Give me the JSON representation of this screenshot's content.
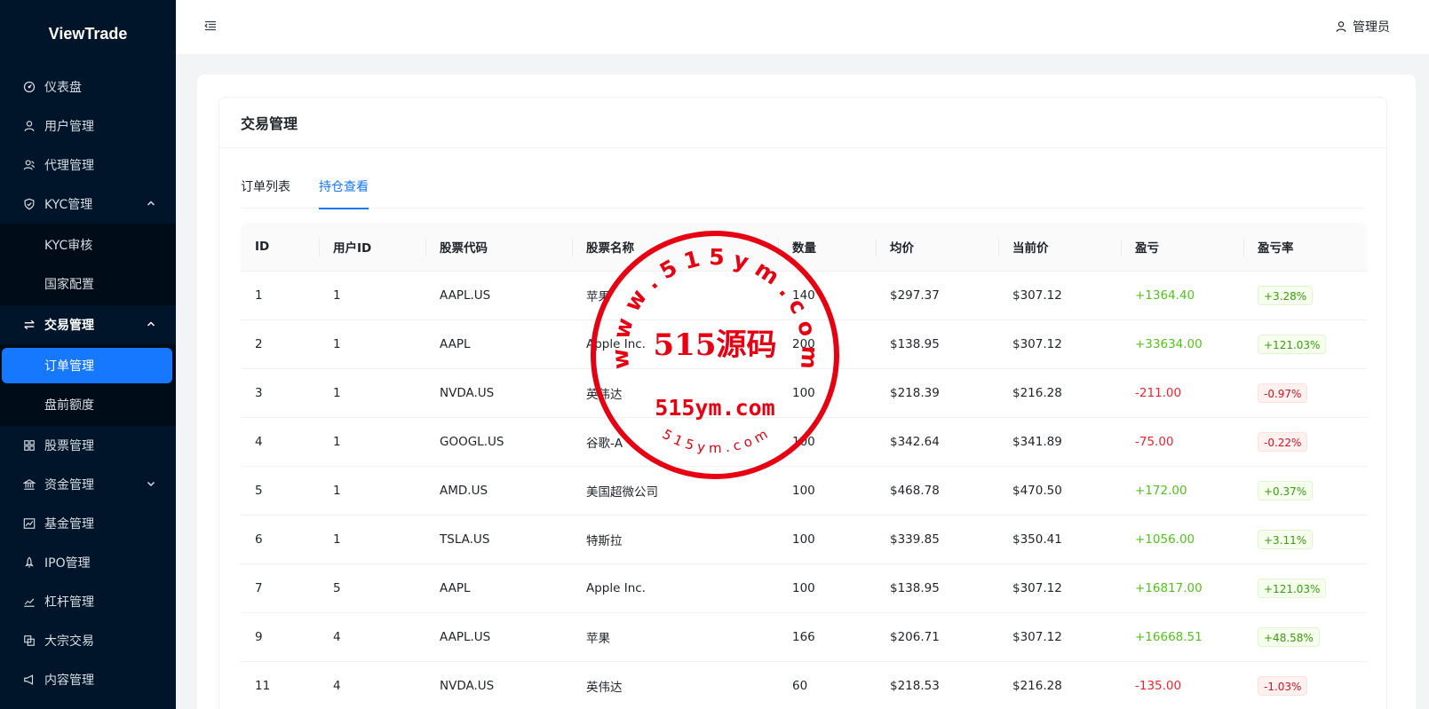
{
  "app": {
    "logo": "ViewTrade"
  },
  "sidebar": {
    "items": [
      {
        "label": "仪表盘",
        "icon": "dashboard-icon"
      },
      {
        "label": "用户管理",
        "icon": "user-icon"
      },
      {
        "label": "代理管理",
        "icon": "agent-icon"
      },
      {
        "label": "KYC管理",
        "icon": "shield-icon",
        "expanded": true,
        "children": [
          {
            "label": "KYC审核"
          },
          {
            "label": "国家配置"
          }
        ]
      },
      {
        "label": "交易管理",
        "icon": "swap-icon",
        "expanded": true,
        "children": [
          {
            "label": "订单管理",
            "selected": true
          },
          {
            "label": "盘前额度"
          }
        ]
      },
      {
        "label": "股票管理",
        "icon": "grid-icon"
      },
      {
        "label": "资金管理",
        "icon": "bank-icon",
        "expanded": false
      },
      {
        "label": "基金管理",
        "icon": "fund-chart-icon"
      },
      {
        "label": "IPO管理",
        "icon": "rocket-icon"
      },
      {
        "label": "杠杆管理",
        "icon": "line-chart-icon"
      },
      {
        "label": "大宗交易",
        "icon": "block-trade-icon"
      },
      {
        "label": "内容管理",
        "icon": "megaphone-icon"
      }
    ]
  },
  "header": {
    "user_label": "管理员"
  },
  "main": {
    "title": "交易管理",
    "tabs": [
      {
        "label": "订单列表",
        "active": false
      },
      {
        "label": "持仓查看",
        "active": true
      }
    ],
    "table": {
      "columns": [
        "ID",
        "用户ID",
        "股票代码",
        "股票名称",
        "数量",
        "均价",
        "当前价",
        "盈亏",
        "盈亏率"
      ],
      "rows": [
        {
          "id": "1",
          "user_id": "1",
          "code": "AAPL.US",
          "name": "苹果",
          "qty": "140",
          "avg": "$297.37",
          "cur": "$307.12",
          "pnl": "+1364.40",
          "rate": "+3.28%",
          "dir": "pos"
        },
        {
          "id": "2",
          "user_id": "1",
          "code": "AAPL",
          "name": "Apple Inc.",
          "qty": "200",
          "avg": "$138.95",
          "cur": "$307.12",
          "pnl": "+33634.00",
          "rate": "+121.03%",
          "dir": "pos"
        },
        {
          "id": "3",
          "user_id": "1",
          "code": "NVDA.US",
          "name": "英伟达",
          "qty": "100",
          "avg": "$218.39",
          "cur": "$216.28",
          "pnl": "-211.00",
          "rate": "-0.97%",
          "dir": "neg"
        },
        {
          "id": "4",
          "user_id": "1",
          "code": "GOOGL.US",
          "name": "谷歌-A",
          "qty": "100",
          "avg": "$342.64",
          "cur": "$341.89",
          "pnl": "-75.00",
          "rate": "-0.22%",
          "dir": "neg"
        },
        {
          "id": "5",
          "user_id": "1",
          "code": "AMD.US",
          "name": "美国超微公司",
          "qty": "100",
          "avg": "$468.78",
          "cur": "$470.50",
          "pnl": "+172.00",
          "rate": "+0.37%",
          "dir": "pos"
        },
        {
          "id": "6",
          "user_id": "1",
          "code": "TSLA.US",
          "name": "特斯拉",
          "qty": "100",
          "avg": "$339.85",
          "cur": "$350.41",
          "pnl": "+1056.00",
          "rate": "+3.11%",
          "dir": "pos"
        },
        {
          "id": "7",
          "user_id": "5",
          "code": "AAPL",
          "name": "Apple Inc.",
          "qty": "100",
          "avg": "$138.95",
          "cur": "$307.12",
          "pnl": "+16817.00",
          "rate": "+121.03%",
          "dir": "pos"
        },
        {
          "id": "9",
          "user_id": "4",
          "code": "AAPL.US",
          "name": "苹果",
          "qty": "166",
          "avg": "$206.71",
          "cur": "$307.12",
          "pnl": "+16668.51",
          "rate": "+48.58%",
          "dir": "pos"
        },
        {
          "id": "11",
          "user_id": "4",
          "code": "NVDA.US",
          "name": "英伟达",
          "qty": "60",
          "avg": "$218.53",
          "cur": "$216.28",
          "pnl": "-135.00",
          "rate": "-1.03%",
          "dir": "neg"
        }
      ]
    }
  },
  "watermark": {
    "ring_text": "w w w . 5 1 5 y m . c o m",
    "center_text": "515源码",
    "domain_text": "515ym.com",
    "bottom_text": "5 1 5 y m . c o m"
  },
  "colors": {
    "sidebar_bg": "#001529",
    "accent": "#1677ff",
    "positive": "#52c41a",
    "negative": "#f5222d",
    "stamp": "#e60012"
  }
}
